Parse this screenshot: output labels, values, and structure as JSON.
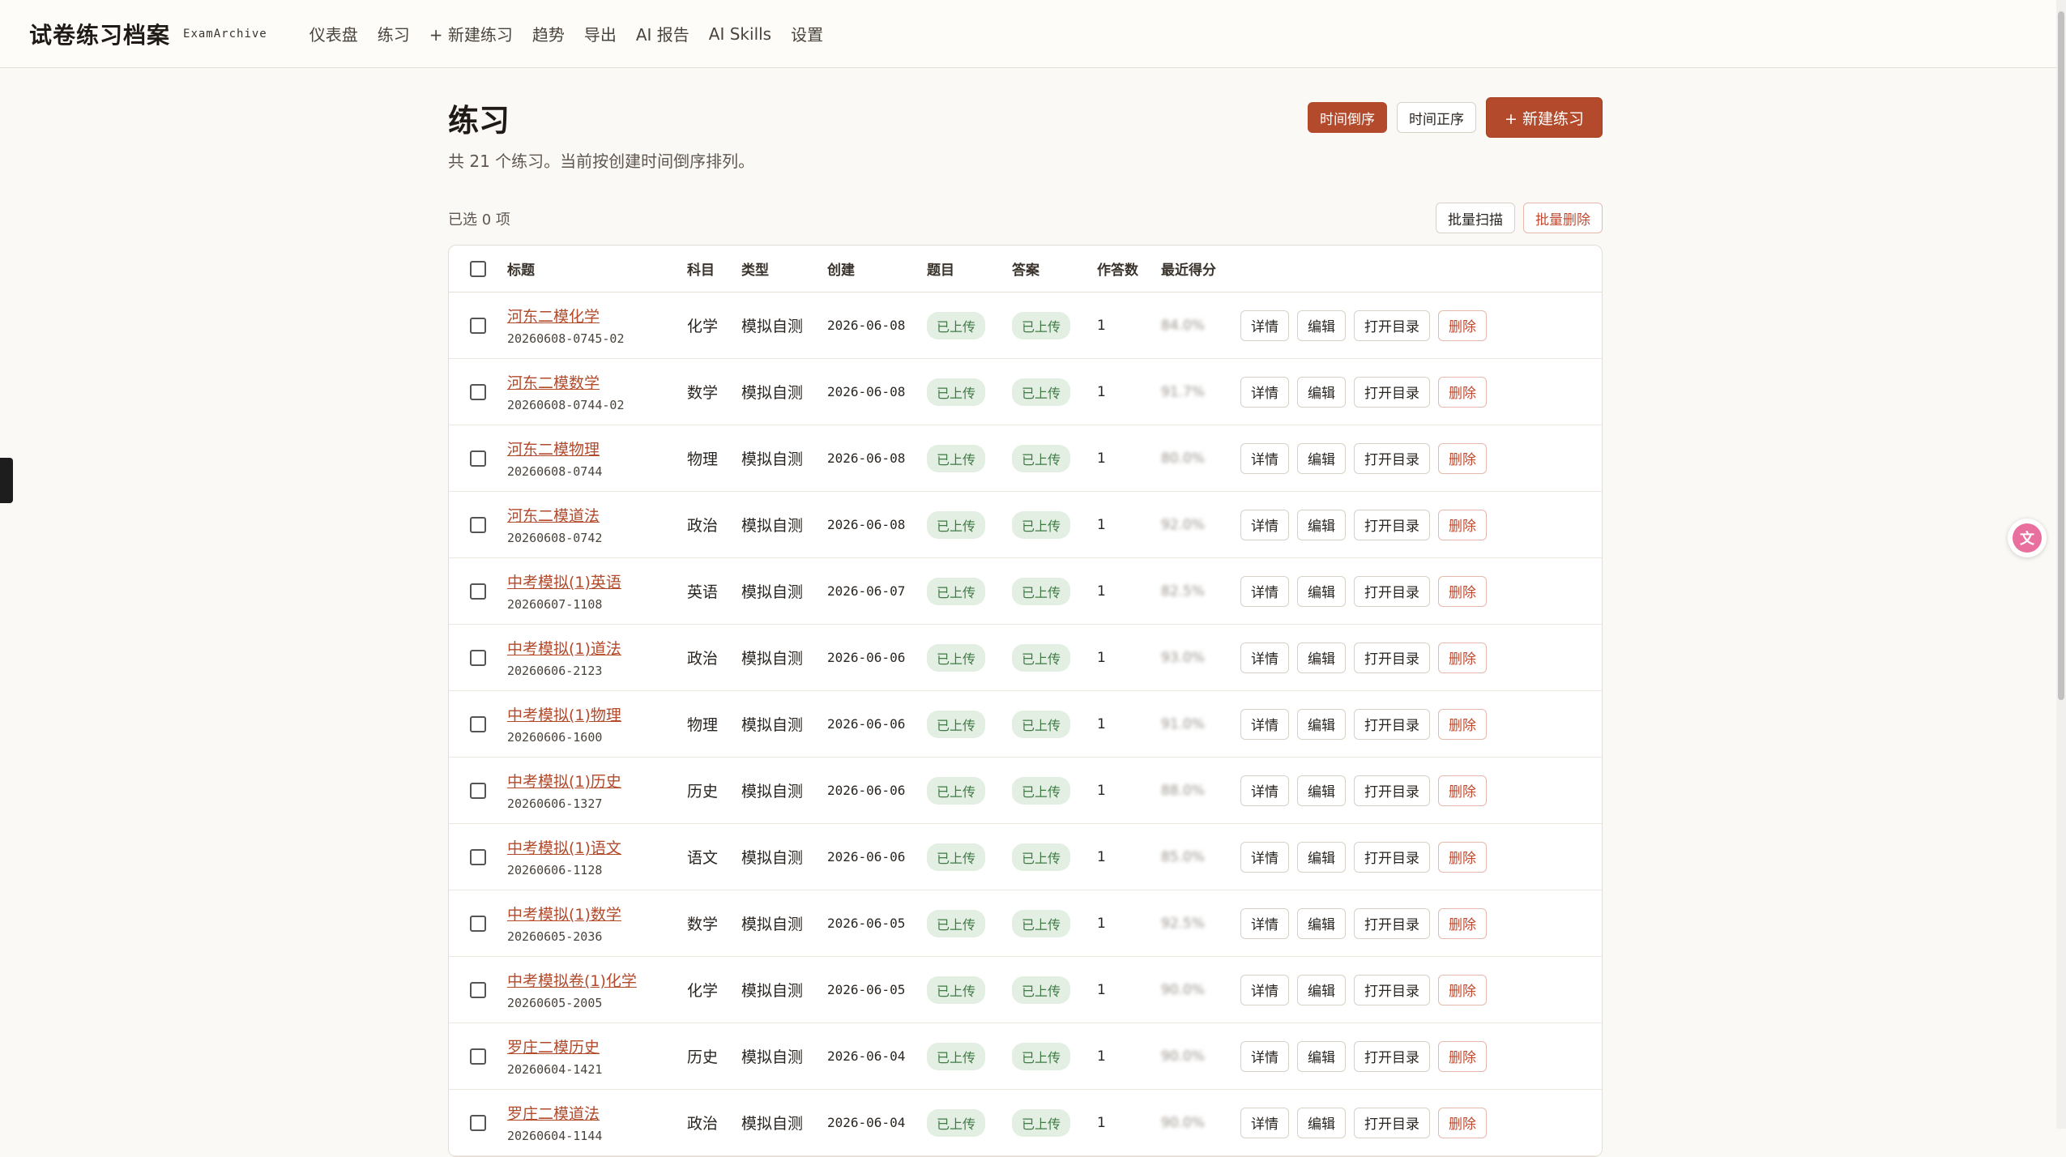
{
  "app": {
    "brand": "试卷练习档案",
    "brand_sub": "ExamArchive"
  },
  "nav": [
    "仪表盘",
    "练习",
    "+ 新建练习",
    "趋势",
    "导出",
    "AI 报告",
    "AI Skills",
    "设置"
  ],
  "page": {
    "title": "练习",
    "subtitle": "共 21 个练习。当前按创建时间倒序排列。",
    "sort_desc": "时间倒序",
    "sort_asc": "时间正序",
    "new_label": "+ 新建练习",
    "selected": "已选 0 项",
    "batch_scan": "批量扫描",
    "batch_delete": "批量删除"
  },
  "table": {
    "headers": {
      "title": "标题",
      "subject": "科目",
      "type": "类型",
      "created": "创建",
      "questions": "题目",
      "answers": "答案",
      "count": "作答数",
      "score": "最近得分"
    },
    "actions": {
      "detail": "详情",
      "edit": "编辑",
      "open": "打开目录",
      "delete": "删除"
    },
    "rows": [
      {
        "title": "河东二模化学",
        "code": "20260608-0745-02",
        "subject": "化学",
        "type": "模拟自测",
        "date": "2026-06-08",
        "q": "已上传",
        "a": "已上传",
        "count": "1",
        "score": "84.0%"
      },
      {
        "title": "河东二模数学",
        "code": "20260608-0744-02",
        "subject": "数学",
        "type": "模拟自测",
        "date": "2026-06-08",
        "q": "已上传",
        "a": "已上传",
        "count": "1",
        "score": "91.7%"
      },
      {
        "title": "河东二模物理",
        "code": "20260608-0744",
        "subject": "物理",
        "type": "模拟自测",
        "date": "2026-06-08",
        "q": "已上传",
        "a": "已上传",
        "count": "1",
        "score": "80.0%"
      },
      {
        "title": "河东二模道法",
        "code": "20260608-0742",
        "subject": "政治",
        "type": "模拟自测",
        "date": "2026-06-08",
        "q": "已上传",
        "a": "已上传",
        "count": "1",
        "score": "92.0%"
      },
      {
        "title": "中考模拟(1)英语",
        "code": "20260607-1108",
        "subject": "英语",
        "type": "模拟自测",
        "date": "2026-06-07",
        "q": "已上传",
        "a": "已上传",
        "count": "1",
        "score": "82.5%"
      },
      {
        "title": "中考模拟(1)道法",
        "code": "20260606-2123",
        "subject": "政治",
        "type": "模拟自测",
        "date": "2026-06-06",
        "q": "已上传",
        "a": "已上传",
        "count": "1",
        "score": "93.0%"
      },
      {
        "title": "中考模拟(1)物理",
        "code": "20260606-1600",
        "subject": "物理",
        "type": "模拟自测",
        "date": "2026-06-06",
        "q": "已上传",
        "a": "已上传",
        "count": "1",
        "score": "91.0%"
      },
      {
        "title": "中考模拟(1)历史",
        "code": "20260606-1327",
        "subject": "历史",
        "type": "模拟自测",
        "date": "2026-06-06",
        "q": "已上传",
        "a": "已上传",
        "count": "1",
        "score": "88.0%"
      },
      {
        "title": "中考模拟(1)语文",
        "code": "20260606-1128",
        "subject": "语文",
        "type": "模拟自测",
        "date": "2026-06-06",
        "q": "已上传",
        "a": "已上传",
        "count": "1",
        "score": "85.0%"
      },
      {
        "title": "中考模拟(1)数学",
        "code": "20260605-2036",
        "subject": "数学",
        "type": "模拟自测",
        "date": "2026-06-05",
        "q": "已上传",
        "a": "已上传",
        "count": "1",
        "score": "92.5%"
      },
      {
        "title": "中考模拟卷(1)化学",
        "code": "20260605-2005",
        "subject": "化学",
        "type": "模拟自测",
        "date": "2026-06-05",
        "q": "已上传",
        "a": "已上传",
        "count": "1",
        "score": "90.0%"
      },
      {
        "title": "罗庄二模历史",
        "code": "20260604-1421",
        "subject": "历史",
        "type": "模拟自测",
        "date": "2026-06-04",
        "q": "已上传",
        "a": "已上传",
        "count": "1",
        "score": "90.0%"
      },
      {
        "title": "罗庄二模道法",
        "code": "20260604-1144",
        "subject": "政治",
        "type": "模拟自测",
        "date": "2026-06-04",
        "q": "已上传",
        "a": "已上传",
        "count": "1",
        "score": "90.0%"
      }
    ]
  }
}
